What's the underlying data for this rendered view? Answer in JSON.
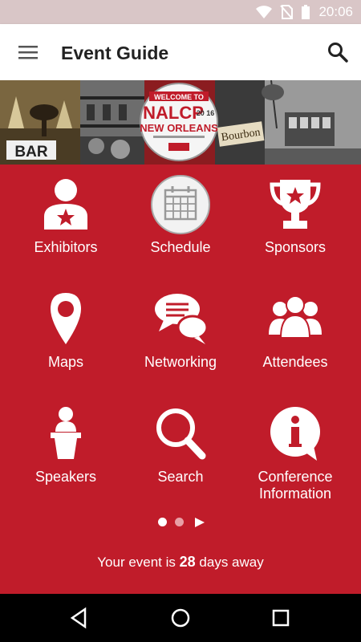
{
  "status_bar": {
    "time": "20:06"
  },
  "app_bar": {
    "title": "Event Guide"
  },
  "banner": {
    "logo_top": "WELCOME TO",
    "logo_main": "NALCP",
    "logo_year": "20 16",
    "logo_city": "NEW ORLEANS",
    "sign_bar": "BAR",
    "sign_bourbon": "Bourbon"
  },
  "tiles": [
    {
      "label": "Exhibitors",
      "icon": "exhibitor-icon"
    },
    {
      "label": "Schedule",
      "icon": "calendar-icon"
    },
    {
      "label": "Sponsors",
      "icon": "trophy-icon"
    },
    {
      "label": "Maps",
      "icon": "map-pin-icon"
    },
    {
      "label": "Networking",
      "icon": "chat-bubbles-icon"
    },
    {
      "label": "Attendees",
      "icon": "people-icon"
    },
    {
      "label": "Speakers",
      "icon": "podium-icon"
    },
    {
      "label": "Search",
      "icon": "search-icon"
    },
    {
      "label": "Conference Information",
      "icon": "info-icon"
    }
  ],
  "pager": {
    "pages": 2,
    "current": 2
  },
  "countdown": {
    "prefix": "Your event is",
    "days": "28",
    "suffix": "days away"
  },
  "colors": {
    "brand_red": "#c01c2a",
    "status_bar": "#d9c6c7",
    "app_bar": "#ffffff"
  }
}
